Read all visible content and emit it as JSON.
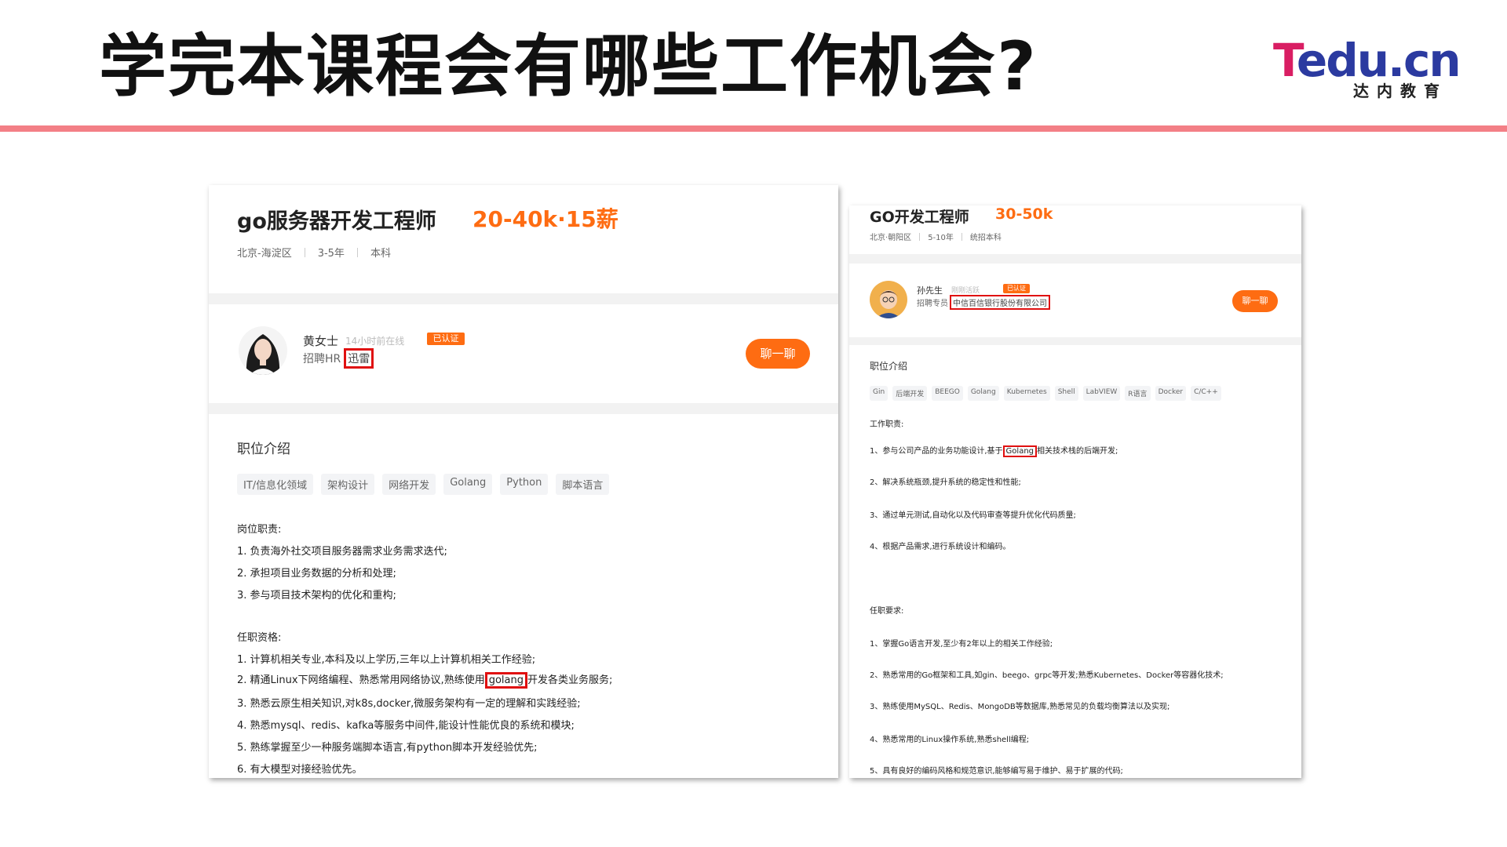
{
  "slide": {
    "title": "学完本课程会有哪些工作机会?",
    "logo": {
      "brand_first": "T",
      "brand_rest": "edu.cn",
      "subtitle": "达内教育"
    },
    "colors": {
      "accent": "#f37f86",
      "salary": "#fe6c12",
      "highlight": "#e01010"
    }
  },
  "left_job": {
    "title": "go服务器开发工程师",
    "salary": "20-40k·15薪",
    "location": "北京-海淀区",
    "experience": "3-5年",
    "education": "本科",
    "recruiter": {
      "name": "黄女士",
      "online": "14小时前在线",
      "verified": "已认证",
      "role": "招聘HR",
      "company": "迅雷"
    },
    "chat_label": "聊一聊",
    "section_title": "职位介绍",
    "tags": [
      "IT/信息化领域",
      "架构设计",
      "网络开发",
      "Golang",
      "Python",
      "脚本语言"
    ],
    "duties_title": "岗位职责:",
    "duties": [
      "1. 负责海外社交项目服务器需求业务需求迭代;",
      "2. 承担项目业务数据的分析和处理;",
      "3. 参与项目技术架构的优化和重构;"
    ],
    "quals_title": "任职资格:",
    "qual_1": "1. 计算机相关专业,本科及以上学历,三年以上计算机相关工作经验;",
    "qual_2_before": "2. 精通Linux下网络编程、熟悉常用网络协议,熟练使用",
    "qual_2_highlight": "golang",
    "qual_2_after": "开发各类业务服务;",
    "quals_rest": [
      "3. 熟悉云原生相关知识,对k8s,docker,微服务架构有一定的理解和实践经验;",
      "4. 熟悉mysql、redis、kafka等服务中间件,能设计性能优良的系统和模块;",
      "5. 熟练掌握至少一种服务端脚本语言,有python脚本开发经验优先;",
      "6. 有大模型对接经验优先。"
    ]
  },
  "right_job": {
    "title": "GO开发工程师",
    "salary": "30-50k",
    "location": "北京·朝阳区",
    "experience": "5-10年",
    "education": "统招本科",
    "recruiter": {
      "name": "孙先生",
      "online": "刚刚活跃",
      "verified": "已认证",
      "role": "招聘专员",
      "company": "中信百信银行股份有限公司"
    },
    "chat_label": "聊一聊",
    "section_title": "职位介绍",
    "tags": [
      "Gin",
      "后端开发",
      "BEEGO",
      "Golang",
      "Kubernetes",
      "Shell",
      "LabVIEW",
      "R语言",
      "Docker",
      "C/C++"
    ],
    "duties_title": "工作职责:",
    "duty_1_before": "1、参与公司产品的业务功能设计,基于",
    "duty_1_highlight": "Golang",
    "duty_1_after": "相关技术栈的后端开发;",
    "duties_rest": [
      "2、解决系统瓶颈,提升系统的稳定性和性能;",
      "3、通过单元测试,自动化以及代码审查等提升优化代码质量;",
      "4、根据产品需求,进行系统设计和编码。"
    ],
    "reqs_title": "任职要求:",
    "reqs": [
      "1、掌握Go语言开发,至少有2年以上的相关工作经验;",
      "2、熟悉常用的Go框架和工具,如gin、beego、grpc等开发;熟悉Kubernetes、Docker等容器化技术;",
      "3、熟练使用MySQL、Redis、MongoDB等数据库,熟悉常见的负载均衡算法以及实现;",
      "4、熟悉常用的Linux操作系统,熟悉shell编程;",
      "5、具有良好的编码风格和规范意识,能够编写易于维护、易于扩展的代码;"
    ]
  }
}
